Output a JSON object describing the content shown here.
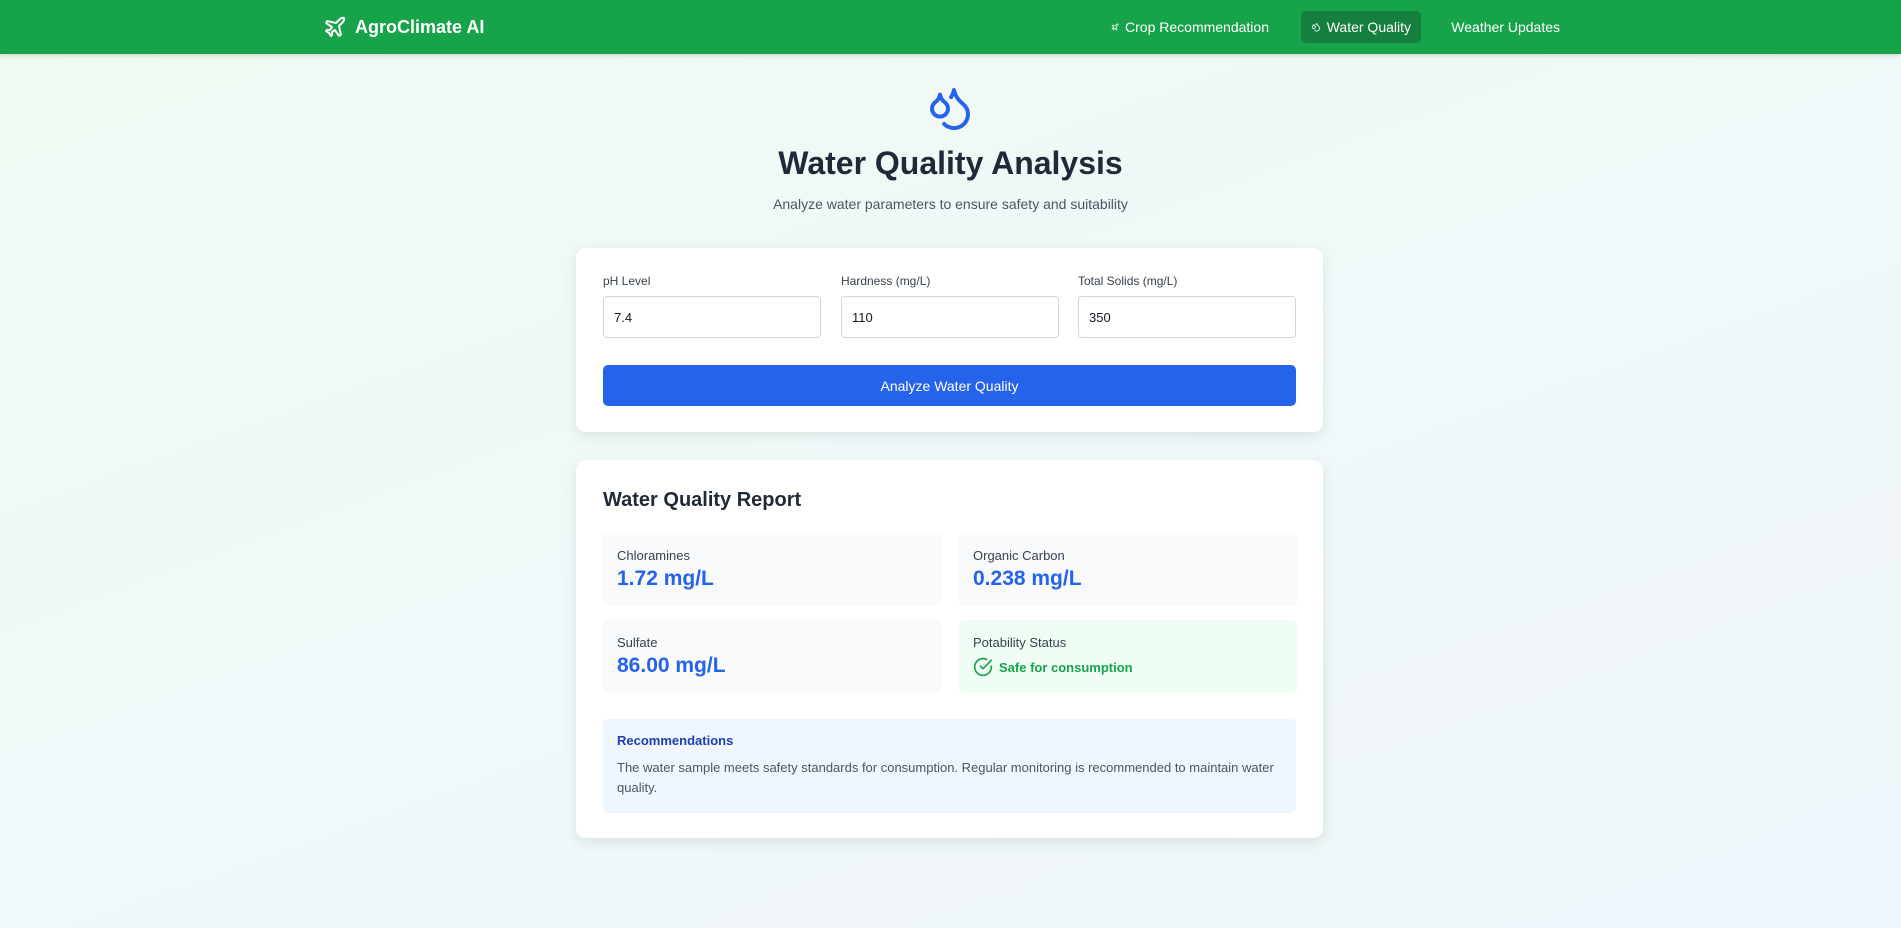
{
  "nav": {
    "brand": "AgroClimate AI",
    "links": [
      {
        "label": "Crop Recommendation",
        "icon": "plane-icon",
        "active": false
      },
      {
        "label": "Water Quality",
        "icon": "droplets-icon",
        "active": true
      },
      {
        "label": "Weather Updates",
        "icon": "cloud-icon",
        "active": false
      }
    ]
  },
  "header": {
    "icon": "droplets-icon",
    "title": "Water Quality Analysis",
    "subtitle": "Analyze water parameters to ensure safety and suitability"
  },
  "form": {
    "fields": [
      {
        "label": "pH Level",
        "value": "7.4"
      },
      {
        "label": "Hardness (mg/L)",
        "value": "110"
      },
      {
        "label": "Total Solids (mg/L)",
        "value": "350"
      }
    ],
    "submit_label": "Analyze Water Quality"
  },
  "report": {
    "title": "Water Quality Report",
    "stats": [
      {
        "label": "Chloramines",
        "value": "1.72 mg/L"
      },
      {
        "label": "Organic Carbon",
        "value": "0.238 mg/L"
      },
      {
        "label": "Sulfate",
        "value": "86.00 mg/L"
      }
    ],
    "potability": {
      "label": "Potability Status",
      "status": "Safe for consumption",
      "icon": "check-circle-icon"
    },
    "recommendations": {
      "title": "Recommendations",
      "text": "The water sample meets safety standards for consumption. Regular monitoring is recommended to maintain water quality."
    }
  },
  "colors": {
    "nav_bg": "#16a34a",
    "nav_active": "#15803d",
    "primary_blue": "#2563eb",
    "safe_green": "#16a34a"
  }
}
